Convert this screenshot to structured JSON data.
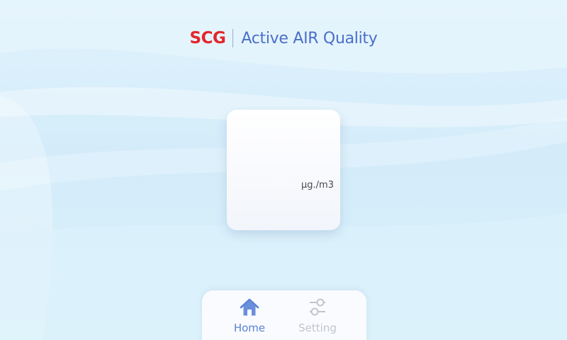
{
  "header": {
    "brand": "SCG",
    "app_title": "Active AIR Quality"
  },
  "reading_card": {
    "unit": "µg./m3"
  },
  "tab_bar": {
    "tabs": [
      {
        "label": "Home",
        "icon": "home-icon",
        "active": true
      },
      {
        "label": "Setting",
        "icon": "settings-sliders-icon",
        "active": false
      }
    ]
  },
  "colors": {
    "brand_red": "#e3262b",
    "title_blue": "#4a6fc9",
    "active_tab": "#5a82d4",
    "inactive_tab": "#c1c5cc",
    "background": "#d9eefb"
  }
}
